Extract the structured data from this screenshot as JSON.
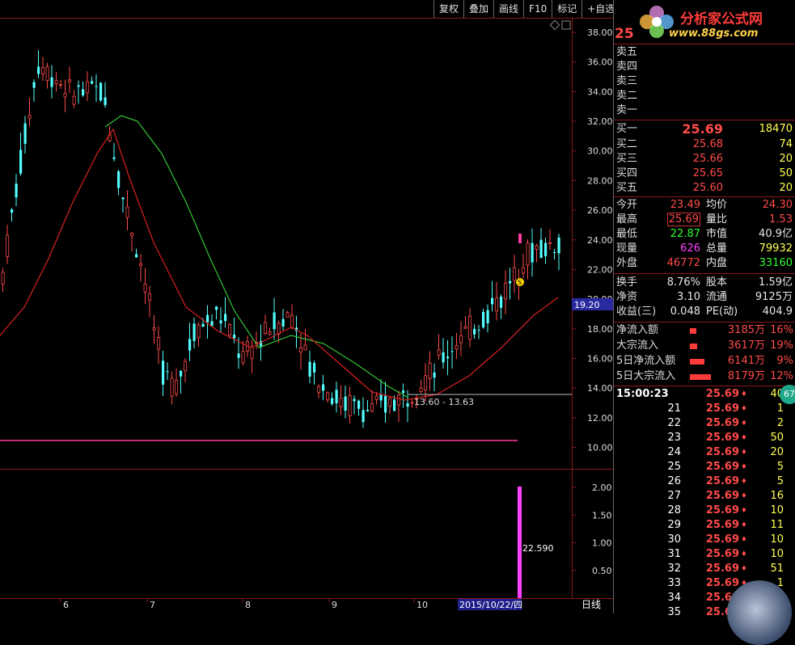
{
  "toolbar": {
    "buttons": [
      "复权",
      "叠加",
      "画线",
      "F10",
      "标记",
      "+自选"
    ]
  },
  "logo": {
    "title": "分析家公式网",
    "url": "www.88gs.com"
  },
  "chart_data": {
    "type": "candlestick",
    "price_axis": {
      "ticks": [
        "38.00",
        "36.00",
        "34.00",
        "32.00",
        "30.00",
        "28.00",
        "26.00",
        "24.00",
        "22.00",
        "20.00",
        "18.00",
        "16.00",
        "14.00",
        "12.00",
        "10.00"
      ],
      "ylim": [
        9,
        39.5
      ]
    },
    "current_price_marker": "19.20",
    "range_label": "13.60 - 13.63",
    "volume_axis": {
      "ticks": [
        "2.00",
        "1.50",
        "1.00",
        "0.50"
      ]
    },
    "volume_label": "22.590",
    "x_axis": {
      "ticks": [
        "6",
        "7",
        "8",
        "9",
        "10"
      ],
      "date_label": "2015/10/22/四",
      "period": "日线"
    }
  },
  "quote": {
    "code_prefix": "25",
    "sell_labels": [
      "卖五",
      "卖四",
      "卖三",
      "卖二",
      "卖一"
    ],
    "buy": [
      {
        "label": "买一",
        "price": "25.69",
        "vol": "18470"
      },
      {
        "label": "买二",
        "price": "25.68",
        "vol": "74"
      },
      {
        "label": "买三",
        "price": "25.66",
        "vol": "20"
      },
      {
        "label": "买四",
        "price": "25.65",
        "vol": "50"
      },
      {
        "label": "买五",
        "price": "25.60",
        "vol": "20"
      }
    ],
    "stats": [
      {
        "l1": "今开",
        "v1": "23.49",
        "l2": "均价",
        "v2": "24.30"
      },
      {
        "l1": "最高",
        "v1": "25.69",
        "l2": "量比",
        "v2": "1.53"
      },
      {
        "l1": "最低",
        "v1": "22.87",
        "l2": "市值",
        "v2": "40.9亿"
      },
      {
        "l1": "现量",
        "v1": "626",
        "l2": "总量",
        "v2": "79932"
      },
      {
        "l1": "外盘",
        "v1": "46772",
        "l2": "内盘",
        "v2": "33160"
      }
    ],
    "stats2": [
      {
        "l1": "换手",
        "v1": "8.76%",
        "l2": "股本",
        "v2": "1.59亿"
      },
      {
        "l1": "净资",
        "v1": "3.10",
        "l2": "流通",
        "v2": "9125万"
      },
      {
        "l1": "收益(三)",
        "v1": "0.048",
        "l2": "PE(动)",
        "v2": "404.9"
      }
    ],
    "flows": [
      {
        "label": "净流入额",
        "value": "3185万",
        "pct": "16%"
      },
      {
        "label": "大宗流入",
        "value": "3617万",
        "pct": "19%"
      },
      {
        "label": "5日净流入额",
        "value": "6141万",
        "pct": "9%"
      },
      {
        "label": "5日大宗流入",
        "value": "8179万",
        "pct": "12%"
      }
    ]
  },
  "ticks": {
    "rows": [
      {
        "t": "15:00:23",
        "p": "25.69",
        "v": "40"
      },
      {
        "t": "21",
        "p": "25.69",
        "v": "1"
      },
      {
        "t": "22",
        "p": "25.69",
        "v": "2"
      },
      {
        "t": "23",
        "p": "25.69",
        "v": "50"
      },
      {
        "t": "24",
        "p": "25.69",
        "v": "20"
      },
      {
        "t": "25",
        "p": "25.69",
        "v": "5"
      },
      {
        "t": "26",
        "p": "25.69",
        "v": "5"
      },
      {
        "t": "27",
        "p": "25.69",
        "v": "16"
      },
      {
        "t": "28",
        "p": "25.69",
        "v": "10"
      },
      {
        "t": "29",
        "p": "25.69",
        "v": "11"
      },
      {
        "t": "30",
        "p": "25.69",
        "v": "10"
      },
      {
        "t": "31",
        "p": "25.69",
        "v": "10"
      },
      {
        "t": "32",
        "p": "25.69",
        "v": "51"
      },
      {
        "t": "33",
        "p": "25.69",
        "v": "1"
      },
      {
        "t": "34",
        "p": "25.69",
        "v": ""
      },
      {
        "t": "35",
        "p": "25.69",
        "v": ""
      }
    ],
    "badge": "67"
  },
  "colors": {
    "up": "#ff4a4a",
    "down": "#54ffff",
    "ma_fast": "#35c535",
    "ma_slow": "#e02020",
    "support": "#ff3aa0"
  }
}
